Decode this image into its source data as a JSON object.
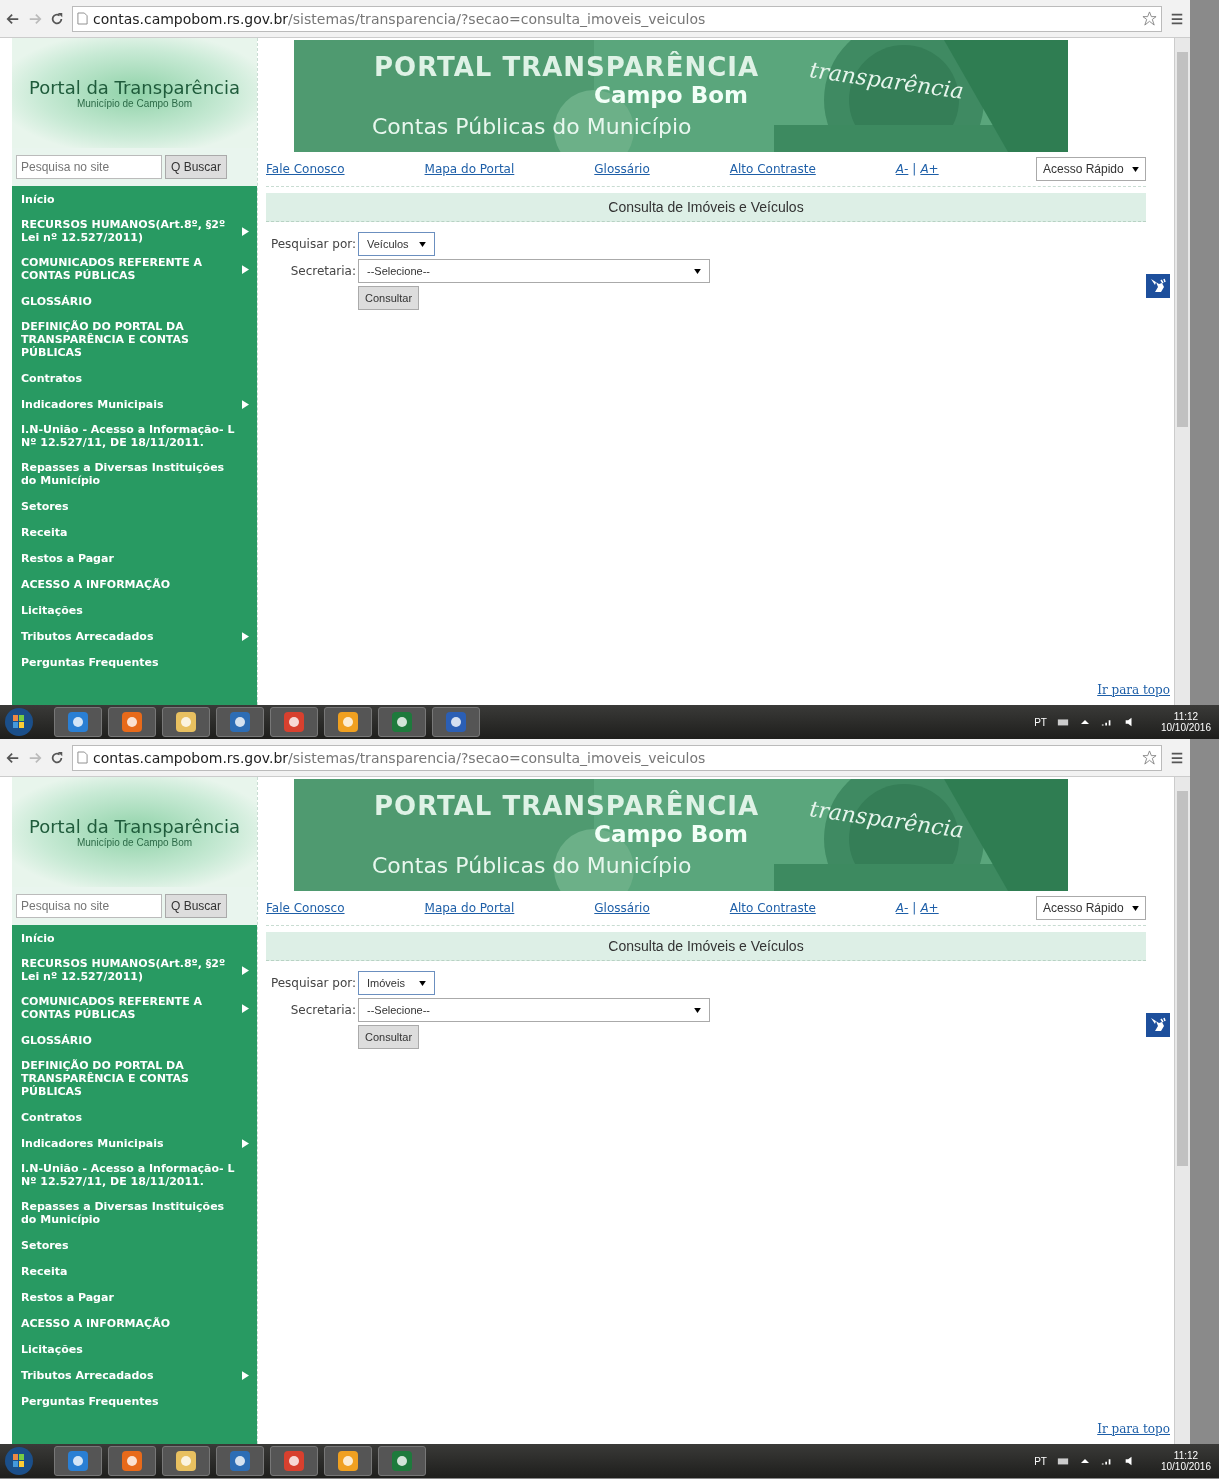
{
  "screens": [
    {
      "address_bar": {
        "host": "contas.campobom.rs.gov.br",
        "path": "/sistemas/transparencia/?secao=consulta_imoveis_veiculos"
      },
      "site": {
        "title": "Portal da Transparência",
        "subtitle": "Município de Campo Bom",
        "search": {
          "placeholder": "Pesquisa no site",
          "button": "Q Buscar"
        },
        "banner": {
          "title": "PORTAL TRANSPARÊNCIA",
          "city": "Campo Bom",
          "tagline": "Contas Públicas do Município",
          "overlay": "transparência"
        },
        "nav_links": [
          "Fale Conosco",
          "Mapa do Portal",
          "Glossário",
          "Alto Contraste"
        ],
        "font_links": [
          "A-",
          "|",
          "A+"
        ],
        "quick_access": "Acesso Rápido",
        "menu": [
          {
            "label": "Início",
            "submenu": false
          },
          {
            "label": "RECURSOS HUMANOS(Art.8º, §2º Lei nº 12.527/2011)",
            "submenu": true
          },
          {
            "label": "COMUNICADOS REFERENTE A CONTAS PÚBLICAS",
            "submenu": true
          },
          {
            "label": "GLOSSÁRIO",
            "submenu": false
          },
          {
            "label": "DEFINIÇÃO DO PORTAL DA TRANSPARÊNCIA E CONTAS PÚBLICAS",
            "submenu": false
          },
          {
            "label": "Contratos",
            "submenu": false
          },
          {
            "label": "Indicadores Municipais",
            "submenu": true
          },
          {
            "label": "I.N-União - Acesso a Informação- L Nº 12.527/11, DE 18/11/2011.",
            "submenu": false
          },
          {
            "label": "Repasses a Diversas Instituições do Município",
            "submenu": false
          },
          {
            "label": "Setores",
            "submenu": false
          },
          {
            "label": "Receita",
            "submenu": false
          },
          {
            "label": "Restos a Pagar",
            "submenu": false
          },
          {
            "label": "ACESSO A INFORMAÇÃO",
            "submenu": false
          },
          {
            "label": "Licitações",
            "submenu": false
          },
          {
            "label": "Tributos Arrecadados",
            "submenu": true
          },
          {
            "label": "Perguntas Frequentes",
            "submenu": false
          }
        ],
        "heading": "Consulta de Imóveis e Veículos",
        "form": {
          "search_by_label": "Pesquisar por:",
          "search_by_value": "Veículos",
          "department_label": "Secretaria:",
          "department_value": "--Selecione--",
          "submit": "Consultar"
        },
        "back_to_top": "Ir para topo"
      },
      "taskbar": {
        "apps": [
          {
            "kind": "ie"
          },
          {
            "kind": "media"
          },
          {
            "kind": "folder"
          },
          {
            "kind": "chat"
          },
          {
            "kind": "chrome"
          },
          {
            "kind": "outlook"
          },
          {
            "kind": "excel"
          },
          {
            "kind": "word"
          }
        ],
        "language": "PT",
        "time": "11:12",
        "date": "10/10/2016"
      }
    },
    {
      "address_bar": {
        "host": "contas.campobom.rs.gov.br",
        "path": "/sistemas/transparencia/?secao=consulta_imoveis_veiculos"
      },
      "site": {
        "title": "Portal da Transparência",
        "subtitle": "Município de Campo Bom",
        "search": {
          "placeholder": "Pesquisa no site",
          "button": "Q Buscar"
        },
        "banner": {
          "title": "PORTAL TRANSPARÊNCIA",
          "city": "Campo Bom",
          "tagline": "Contas Públicas do Município",
          "overlay": "transparência"
        },
        "nav_links": [
          "Fale Conosco",
          "Mapa do Portal",
          "Glossário",
          "Alto Contraste"
        ],
        "font_links": [
          "A-",
          "|",
          "A+"
        ],
        "quick_access": "Acesso Rápido",
        "menu": [
          {
            "label": "Início",
            "submenu": false
          },
          {
            "label": "RECURSOS HUMANOS(Art.8º, §2º Lei nº 12.527/2011)",
            "submenu": true
          },
          {
            "label": "COMUNICADOS REFERENTE A CONTAS PÚBLICAS",
            "submenu": true
          },
          {
            "label": "GLOSSÁRIO",
            "submenu": false
          },
          {
            "label": "DEFINIÇÃO DO PORTAL DA TRANSPARÊNCIA E CONTAS PÚBLICAS",
            "submenu": false
          },
          {
            "label": "Contratos",
            "submenu": false
          },
          {
            "label": "Indicadores Municipais",
            "submenu": true
          },
          {
            "label": "I.N-União - Acesso a Informação- L Nº 12.527/11, DE 18/11/2011.",
            "submenu": false
          },
          {
            "label": "Repasses a Diversas Instituições do Município",
            "submenu": false
          },
          {
            "label": "Setores",
            "submenu": false
          },
          {
            "label": "Receita",
            "submenu": false
          },
          {
            "label": "Restos a Pagar",
            "submenu": false
          },
          {
            "label": "ACESSO A INFORMAÇÃO",
            "submenu": false
          },
          {
            "label": "Licitações",
            "submenu": false
          },
          {
            "label": "Tributos Arrecadados",
            "submenu": true
          },
          {
            "label": "Perguntas Frequentes",
            "submenu": false
          }
        ],
        "heading": "Consulta de Imóveis e Veículos",
        "form": {
          "search_by_label": "Pesquisar por:",
          "search_by_value": "Imóveis",
          "department_label": "Secretaria:",
          "department_value": "--Selecione--",
          "submit": "Consultar"
        },
        "back_to_top": "Ir para topo"
      },
      "taskbar": {
        "apps": [
          {
            "kind": "ie"
          },
          {
            "kind": "media"
          },
          {
            "kind": "folder"
          },
          {
            "kind": "chat"
          },
          {
            "kind": "chrome"
          },
          {
            "kind": "outlook"
          },
          {
            "kind": "excel"
          }
        ],
        "language": "PT",
        "time": "11:12",
        "date": "10/10/2016"
      }
    }
  ]
}
